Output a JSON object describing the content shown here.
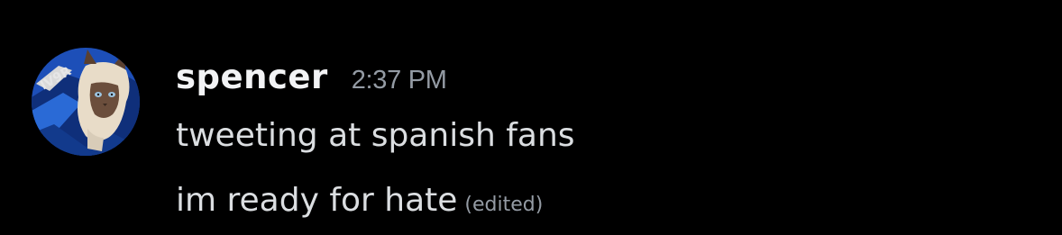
{
  "message": {
    "author": "spencer",
    "timestamp": "2:37 PM",
    "avatar_icon": "cat-avatar-icon",
    "lines": [
      {
        "text": "tweeting at spanish fans"
      },
      {
        "text": "im ready for hate",
        "edited_label": "(edited)"
      }
    ]
  },
  "colors": {
    "background": "#000000",
    "username": "#f2f3f5",
    "message_text": "#dbdee1",
    "muted": "#949ba4"
  }
}
